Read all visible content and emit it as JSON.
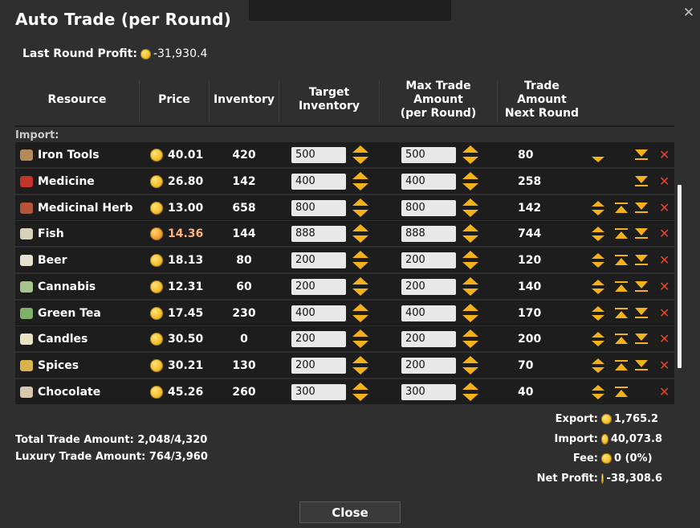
{
  "window": {
    "title": "Auto Trade (per Round)",
    "close_glyph": "✕"
  },
  "last_round": {
    "label": "Last Round Profit:",
    "value": "-31,930.4"
  },
  "columns": {
    "resource": "Resource",
    "price": "Price",
    "inventory": "Inventory",
    "target_inventory": "Target Inventory",
    "max_trade_l1": "Max Trade Amount",
    "max_trade_l2": "(per Round)",
    "next_round_l1": "Trade Amount",
    "next_round_l2": "Next Round"
  },
  "section_label": "Import:",
  "rows": [
    {
      "name": "Iron Tools",
      "icon": "crate-icon",
      "color": "#b58a5a",
      "price": "40.01",
      "price_orange": false,
      "inventory": "420",
      "target": "500",
      "max": "500",
      "next": "80",
      "up": false,
      "down": true,
      "top": false,
      "bottom": true
    },
    {
      "name": "Medicine",
      "icon": "potion-icon",
      "color": "#c2342c",
      "price": "26.80",
      "price_orange": false,
      "inventory": "142",
      "target": "400",
      "max": "400",
      "next": "258",
      "up": false,
      "down": false,
      "top": false,
      "bottom": true
    },
    {
      "name": "Medicinal Herb",
      "icon": "herb-bowl-icon",
      "color": "#b9523a",
      "price": "13.00",
      "price_orange": false,
      "inventory": "658",
      "target": "800",
      "max": "800",
      "next": "142",
      "up": true,
      "down": true,
      "top": true,
      "bottom": true
    },
    {
      "name": "Fish",
      "icon": "fish-icon",
      "color": "#d9d2b8",
      "price": "14.36",
      "price_orange": true,
      "inventory": "144",
      "target": "888",
      "max": "888",
      "next": "744",
      "up": true,
      "down": true,
      "top": true,
      "bottom": true
    },
    {
      "name": "Beer",
      "icon": "beer-icon",
      "color": "#e6e0cf",
      "price": "18.13",
      "price_orange": false,
      "inventory": "80",
      "target": "200",
      "max": "200",
      "next": "120",
      "up": true,
      "down": true,
      "top": true,
      "bottom": true
    },
    {
      "name": "Cannabis",
      "icon": "cannabis-icon",
      "color": "#a7c28a",
      "price": "12.31",
      "price_orange": false,
      "inventory": "60",
      "target": "200",
      "max": "200",
      "next": "140",
      "up": true,
      "down": true,
      "top": true,
      "bottom": true
    },
    {
      "name": "Green Tea",
      "icon": "tea-icon",
      "color": "#7fb06a",
      "price": "17.45",
      "price_orange": false,
      "inventory": "230",
      "target": "400",
      "max": "400",
      "next": "170",
      "up": true,
      "down": true,
      "top": true,
      "bottom": true
    },
    {
      "name": "Candles",
      "icon": "candles-icon",
      "color": "#e8e1c6",
      "price": "30.50",
      "price_orange": false,
      "inventory": "0",
      "target": "200",
      "max": "200",
      "next": "200",
      "up": true,
      "down": true,
      "top": true,
      "bottom": true
    },
    {
      "name": "Spices",
      "icon": "spices-icon",
      "color": "#d8b24a",
      "price": "30.21",
      "price_orange": false,
      "inventory": "130",
      "target": "200",
      "max": "200",
      "next": "70",
      "up": true,
      "down": true,
      "top": true,
      "bottom": true
    },
    {
      "name": "Chocolate",
      "icon": "chocolate-icon",
      "color": "#d8c7b0",
      "price": "45.26",
      "price_orange": false,
      "inventory": "260",
      "target": "300",
      "max": "300",
      "next": "40",
      "up": true,
      "down": true,
      "top": true,
      "bottom": false
    }
  ],
  "totals": {
    "total_label": "Total Trade Amount:",
    "total_value": "2,048/4,320",
    "luxury_label": "Luxury Trade Amount:",
    "luxury_value": "764/3,960"
  },
  "summary": {
    "export_label": "Export:",
    "export_value": "1,765.2",
    "import_label": "Import:",
    "import_value": "40,073.8",
    "fee_label": "Fee:",
    "fee_value": "0 (0%)",
    "net_label": "Net Profit:",
    "net_value": "-38,308.6"
  },
  "close_label": "Close",
  "colors": {
    "accent": "#f3b21b",
    "delete": "#e0472a",
    "row_bg": "#1d1d1d",
    "bg": "#2f2f2f"
  }
}
